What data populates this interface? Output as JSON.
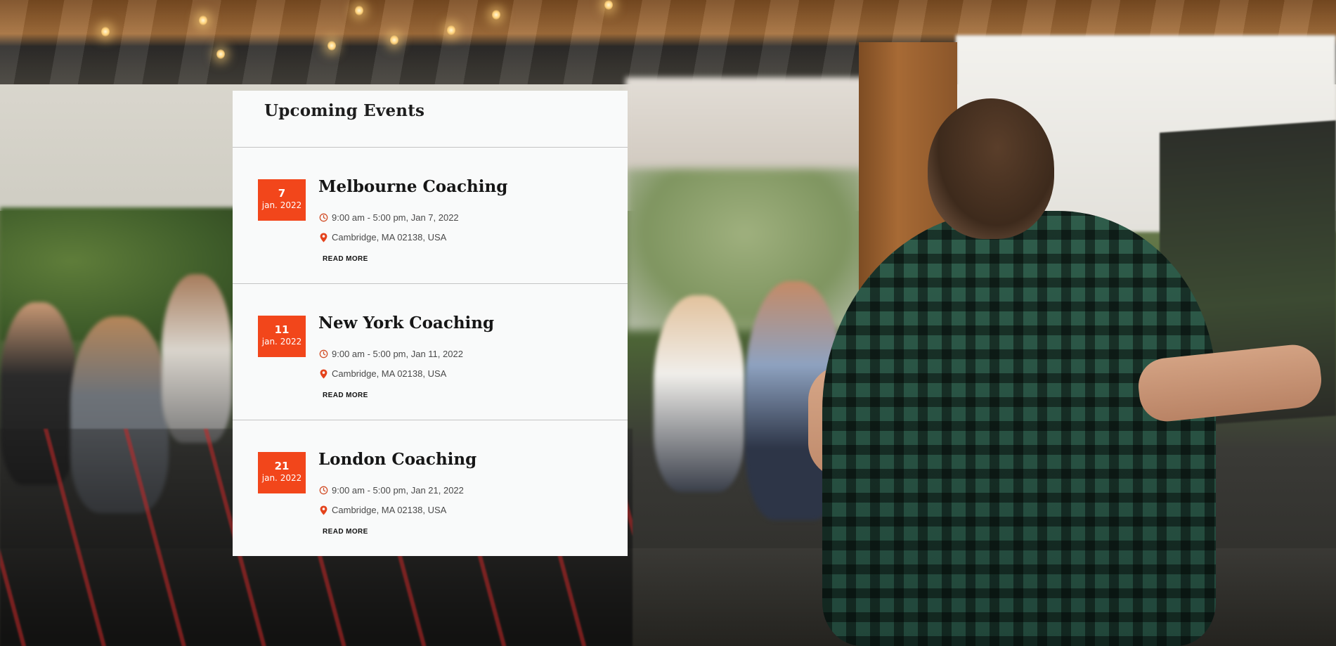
{
  "panel": {
    "title": "Upcoming Events"
  },
  "events": [
    {
      "day": "7",
      "month": "jan. 2022",
      "title": "Melbourne Coaching",
      "time": "9:00 am - 5:00 pm, Jan 7, 2022",
      "location": "Cambridge, MA 02138, USA",
      "read_more": "READ MORE"
    },
    {
      "day": "11",
      "month": "jan. 2022",
      "title": "New York Coaching",
      "time": "9:00 am - 5:00 pm, Jan 11, 2022",
      "location": "Cambridge, MA 02138, USA",
      "read_more": "READ MORE"
    },
    {
      "day": "21",
      "month": "jan. 2022",
      "title": "London Coaching",
      "time": "9:00 am - 5:00 pm, Jan 21, 2022",
      "location": "Cambridge, MA 02138, USA",
      "read_more": "READ MORE"
    }
  ],
  "icons": {
    "time": "clock-icon",
    "location": "map-pin-icon"
  },
  "colors": {
    "accent": "#f2461b",
    "panel_background": "#f9fafa",
    "title_text": "#161616",
    "meta_text": "#4a4a4a"
  }
}
